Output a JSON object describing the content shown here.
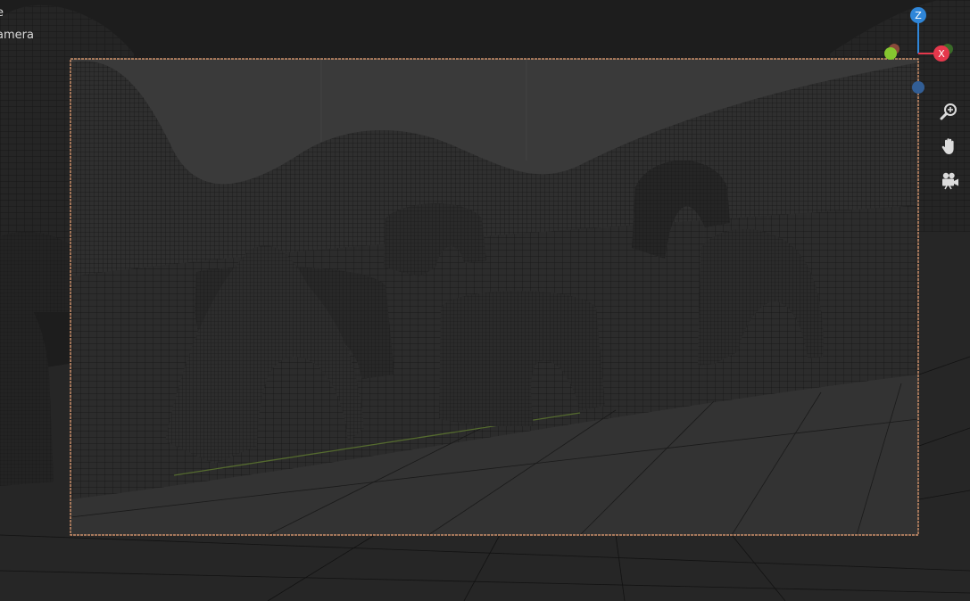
{
  "overlay": {
    "line1": "e",
    "line2": "amera"
  },
  "gizmo": {
    "z_label": "Z",
    "x_label": "X",
    "colors": {
      "z": "#2f86d9",
      "x": "#e5384c",
      "y": "#86c730",
      "neg": "#325e95"
    }
  },
  "nav": {
    "zoom_icon": "zoom-in-icon",
    "pan_icon": "hand-icon",
    "camera_icon": "camera-view-icon"
  },
  "colors": {
    "background": "#1d1d1d",
    "camera_frame": "#f0a678",
    "camera_fill": "#3a3a3a",
    "mesh_dark": "#2a2a2a",
    "wire": "#111111",
    "ground_line": "#556b2f"
  }
}
